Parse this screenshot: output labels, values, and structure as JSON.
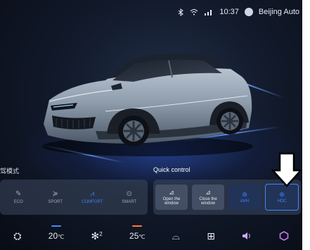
{
  "status": {
    "time": "10:37",
    "location": "Beijing Auto",
    "icons": [
      "bluetooth-icon",
      "wifi-icon",
      "signal-icon",
      "avatar-icon"
    ]
  },
  "drive_mode": {
    "title": "驾模式",
    "modes": [
      {
        "label": "ECO",
        "icon": "leaf-icon",
        "active": false
      },
      {
        "label": "SPORT",
        "icon": "sport-icon",
        "active": false
      },
      {
        "label": "COMFORT",
        "icon": "comfort-icon",
        "active": true
      },
      {
        "label": "SMART",
        "icon": "smart-icon",
        "active": false
      }
    ]
  },
  "quick_control": {
    "title": "Quick control",
    "items": [
      {
        "label": "Open the window",
        "icon": "window-open-icon"
      },
      {
        "label": "Close the window",
        "icon": "window-close-icon"
      },
      {
        "label": "AVH",
        "icon": "avh-icon"
      },
      {
        "label": "HDC",
        "icon": "hdc-icon"
      }
    ]
  },
  "bottom": {
    "left_temp": "20",
    "right_temp": "25",
    "temp_unit": "℃",
    "fan_level": "2",
    "left_temp_color": "#3b8cff",
    "right_temp_color": "#ff7a3d"
  },
  "colors": {
    "accent": "#3f7dff"
  }
}
